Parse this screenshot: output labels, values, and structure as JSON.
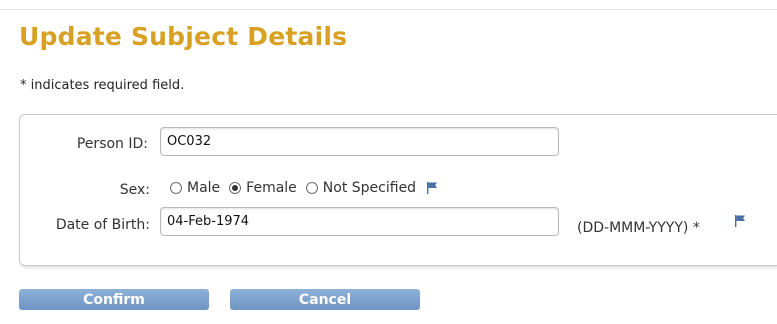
{
  "page": {
    "title": "Update Subject Details",
    "required_note": "* indicates required field."
  },
  "form": {
    "person_id": {
      "label": "Person ID:",
      "value": "OC032"
    },
    "sex": {
      "label": "Sex:",
      "options": [
        "Male",
        "Female",
        "Not Specified"
      ],
      "selected": "Female"
    },
    "dob": {
      "label": "Date of Birth:",
      "value": "04-Feb-1974",
      "format_hint": "(DD-MMM-YYYY) *"
    }
  },
  "buttons": {
    "confirm": "Confirm",
    "cancel": "Cancel"
  },
  "colors": {
    "title": "#d8a124",
    "button": "#7aa0cd",
    "flag": "#4a6fa5"
  },
  "icons": {
    "flag": "flag-icon"
  }
}
